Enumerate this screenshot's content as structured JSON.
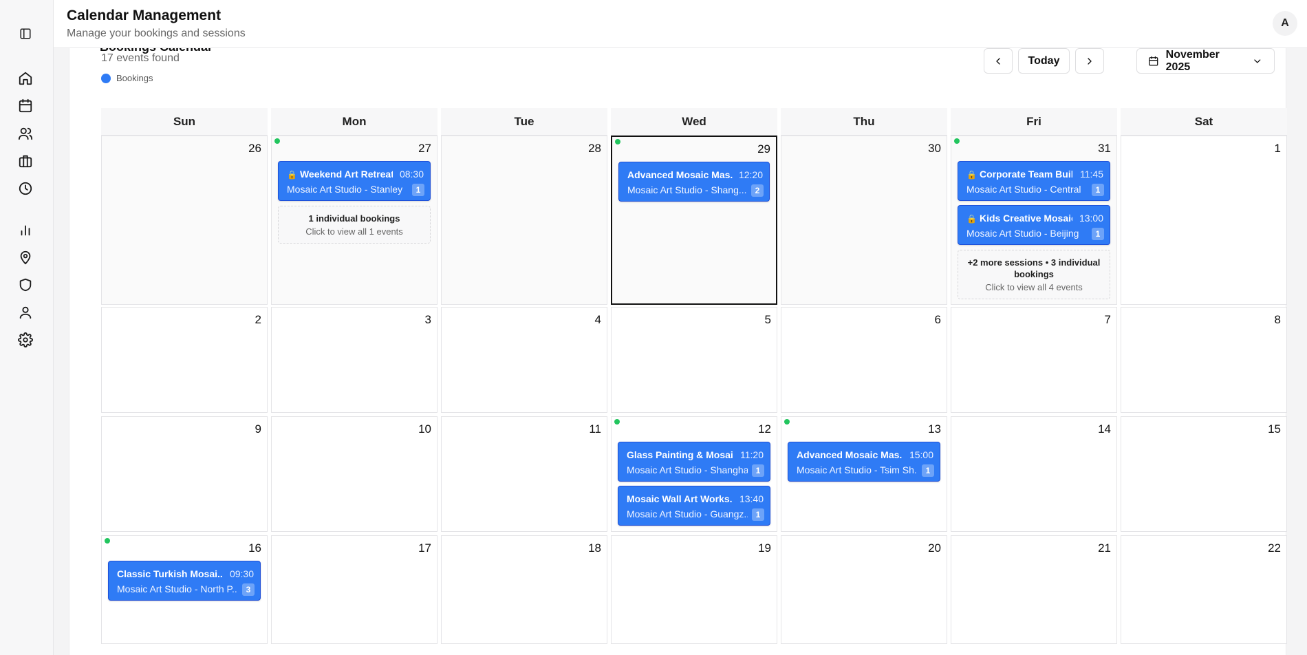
{
  "app": {
    "title": "Calendar Management",
    "subtitle": "Manage your bookings and sessions",
    "avatar_initial": "A"
  },
  "sidebar": {
    "items": [
      {
        "name": "sidebar-toggle",
        "icon": "panel-left-icon"
      },
      {
        "name": "home",
        "icon": "home-icon"
      },
      {
        "name": "calendar",
        "icon": "calendar-icon"
      },
      {
        "name": "users",
        "icon": "users-icon"
      },
      {
        "name": "briefcase",
        "icon": "briefcase-icon"
      },
      {
        "name": "clock",
        "icon": "clock-icon"
      },
      {
        "name": "analytics",
        "icon": "bar-chart-icon"
      },
      {
        "name": "locations",
        "icon": "map-pin-icon"
      },
      {
        "name": "security",
        "icon": "shield-icon"
      },
      {
        "name": "profile",
        "icon": "user-icon"
      },
      {
        "name": "settings",
        "icon": "gear-icon"
      }
    ]
  },
  "calendar": {
    "title": "Bookings Calendar",
    "count": "17 events found",
    "legend_label": "Bookings",
    "today_label": "Today",
    "month_label": "November 2025",
    "days": [
      "Sun",
      "Mon",
      "Tue",
      "Wed",
      "Thu",
      "Fri",
      "Sat"
    ],
    "weeks": [
      [
        {
          "day": "26",
          "other": true
        },
        {
          "day": "27",
          "other": true,
          "dot": true,
          "events": [
            {
              "lock": true,
              "title": "Weekend Art Retreat:",
              "time": "08:30",
              "location": "Mosaic Art Studio - Stanley",
              "count": "1"
            }
          ],
          "more": {
            "title": "1 individual bookings",
            "sub": "Click to view all 1 events"
          }
        },
        {
          "day": "28",
          "other": true
        },
        {
          "day": "29",
          "other": true,
          "today": true,
          "dot": true,
          "events": [
            {
              "lock": false,
              "title": "Advanced Mosaic Mas...",
              "time": "12:20",
              "location": "Mosaic Art Studio - Shang...",
              "count": "2"
            }
          ]
        },
        {
          "day": "30",
          "other": true
        },
        {
          "day": "31",
          "other": true,
          "dot": true,
          "events": [
            {
              "lock": true,
              "title": "Corporate Team Buildi",
              "time": "11:45",
              "location": "Mosaic Art Studio - Central",
              "count": "1"
            },
            {
              "lock": true,
              "title": "Kids Creative Mosaic",
              "time": "13:00",
              "location": "Mosaic Art Studio - Beijing",
              "count": "1"
            }
          ],
          "more": {
            "title": "+2 more sessions • 3 individual bookings",
            "sub": "Click to view all 4 events"
          }
        },
        {
          "day": "1"
        }
      ],
      [
        {
          "day": "2"
        },
        {
          "day": "3"
        },
        {
          "day": "4"
        },
        {
          "day": "5"
        },
        {
          "day": "6"
        },
        {
          "day": "7"
        },
        {
          "day": "8"
        }
      ],
      [
        {
          "day": "9"
        },
        {
          "day": "10"
        },
        {
          "day": "11"
        },
        {
          "day": "12",
          "dot": true,
          "events": [
            {
              "lock": false,
              "title": "Glass Painting & Mosai...",
              "time": "11:20",
              "location": "Mosaic Art Studio - Shanghai",
              "count": "1"
            },
            {
              "lock": false,
              "title": "Mosaic Wall Art Works...",
              "time": "13:40",
              "location": "Mosaic Art Studio - Guangz...",
              "count": "1"
            }
          ]
        },
        {
          "day": "13",
          "dot": true,
          "events": [
            {
              "lock": false,
              "title": "Advanced Mosaic Mas...",
              "time": "15:00",
              "location": "Mosaic Art Studio - Tsim Sh...",
              "count": "1"
            }
          ]
        },
        {
          "day": "14"
        },
        {
          "day": "15"
        }
      ],
      [
        {
          "day": "16",
          "dot": true,
          "events": [
            {
              "lock": false,
              "title": "Classic Turkish Mosai...",
              "time": "09:30",
              "location": "Mosaic Art Studio - North P...",
              "count": "3"
            }
          ]
        },
        {
          "day": "17"
        },
        {
          "day": "18"
        },
        {
          "day": "19"
        },
        {
          "day": "20"
        },
        {
          "day": "21"
        },
        {
          "day": "22"
        }
      ]
    ]
  }
}
